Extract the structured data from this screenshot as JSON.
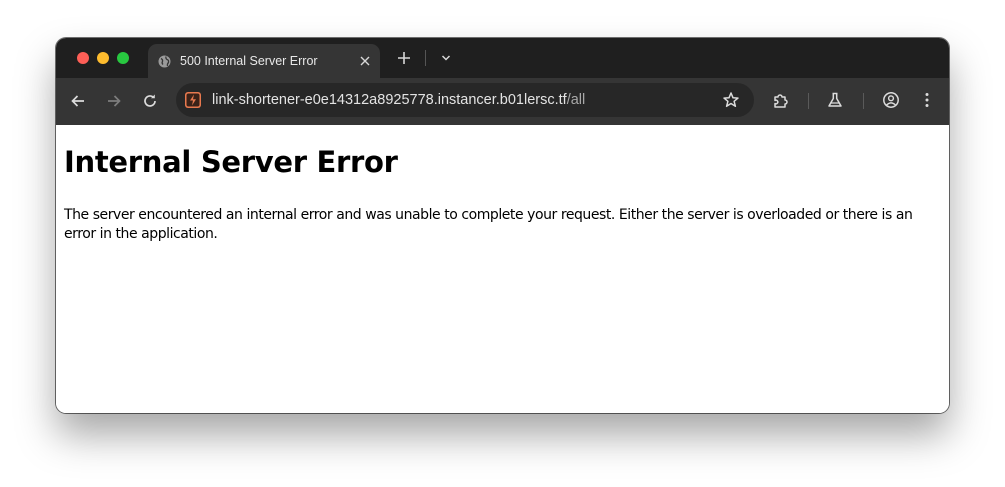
{
  "tab": {
    "title": "500 Internal Server Error",
    "favicon": "globe-icon"
  },
  "toolbar": {
    "url_host": "link-shortener-e0e14312a8925778.instancer.b01lersc.tf",
    "url_path": "/all",
    "site_icon": "lightning-bolt-icon"
  },
  "page": {
    "heading": "Internal Server Error",
    "message": "The server encountered an internal error and was unable to complete your request. Either the server is overloaded or there is an error in the application."
  },
  "colors": {
    "titlebar": "#1f1f1f",
    "toolbar": "#353535",
    "omnibox": "#272727",
    "site_icon_accent": "#e8794f",
    "close": "#fe5f57",
    "minimize": "#febc2e",
    "maximize": "#28c840"
  }
}
